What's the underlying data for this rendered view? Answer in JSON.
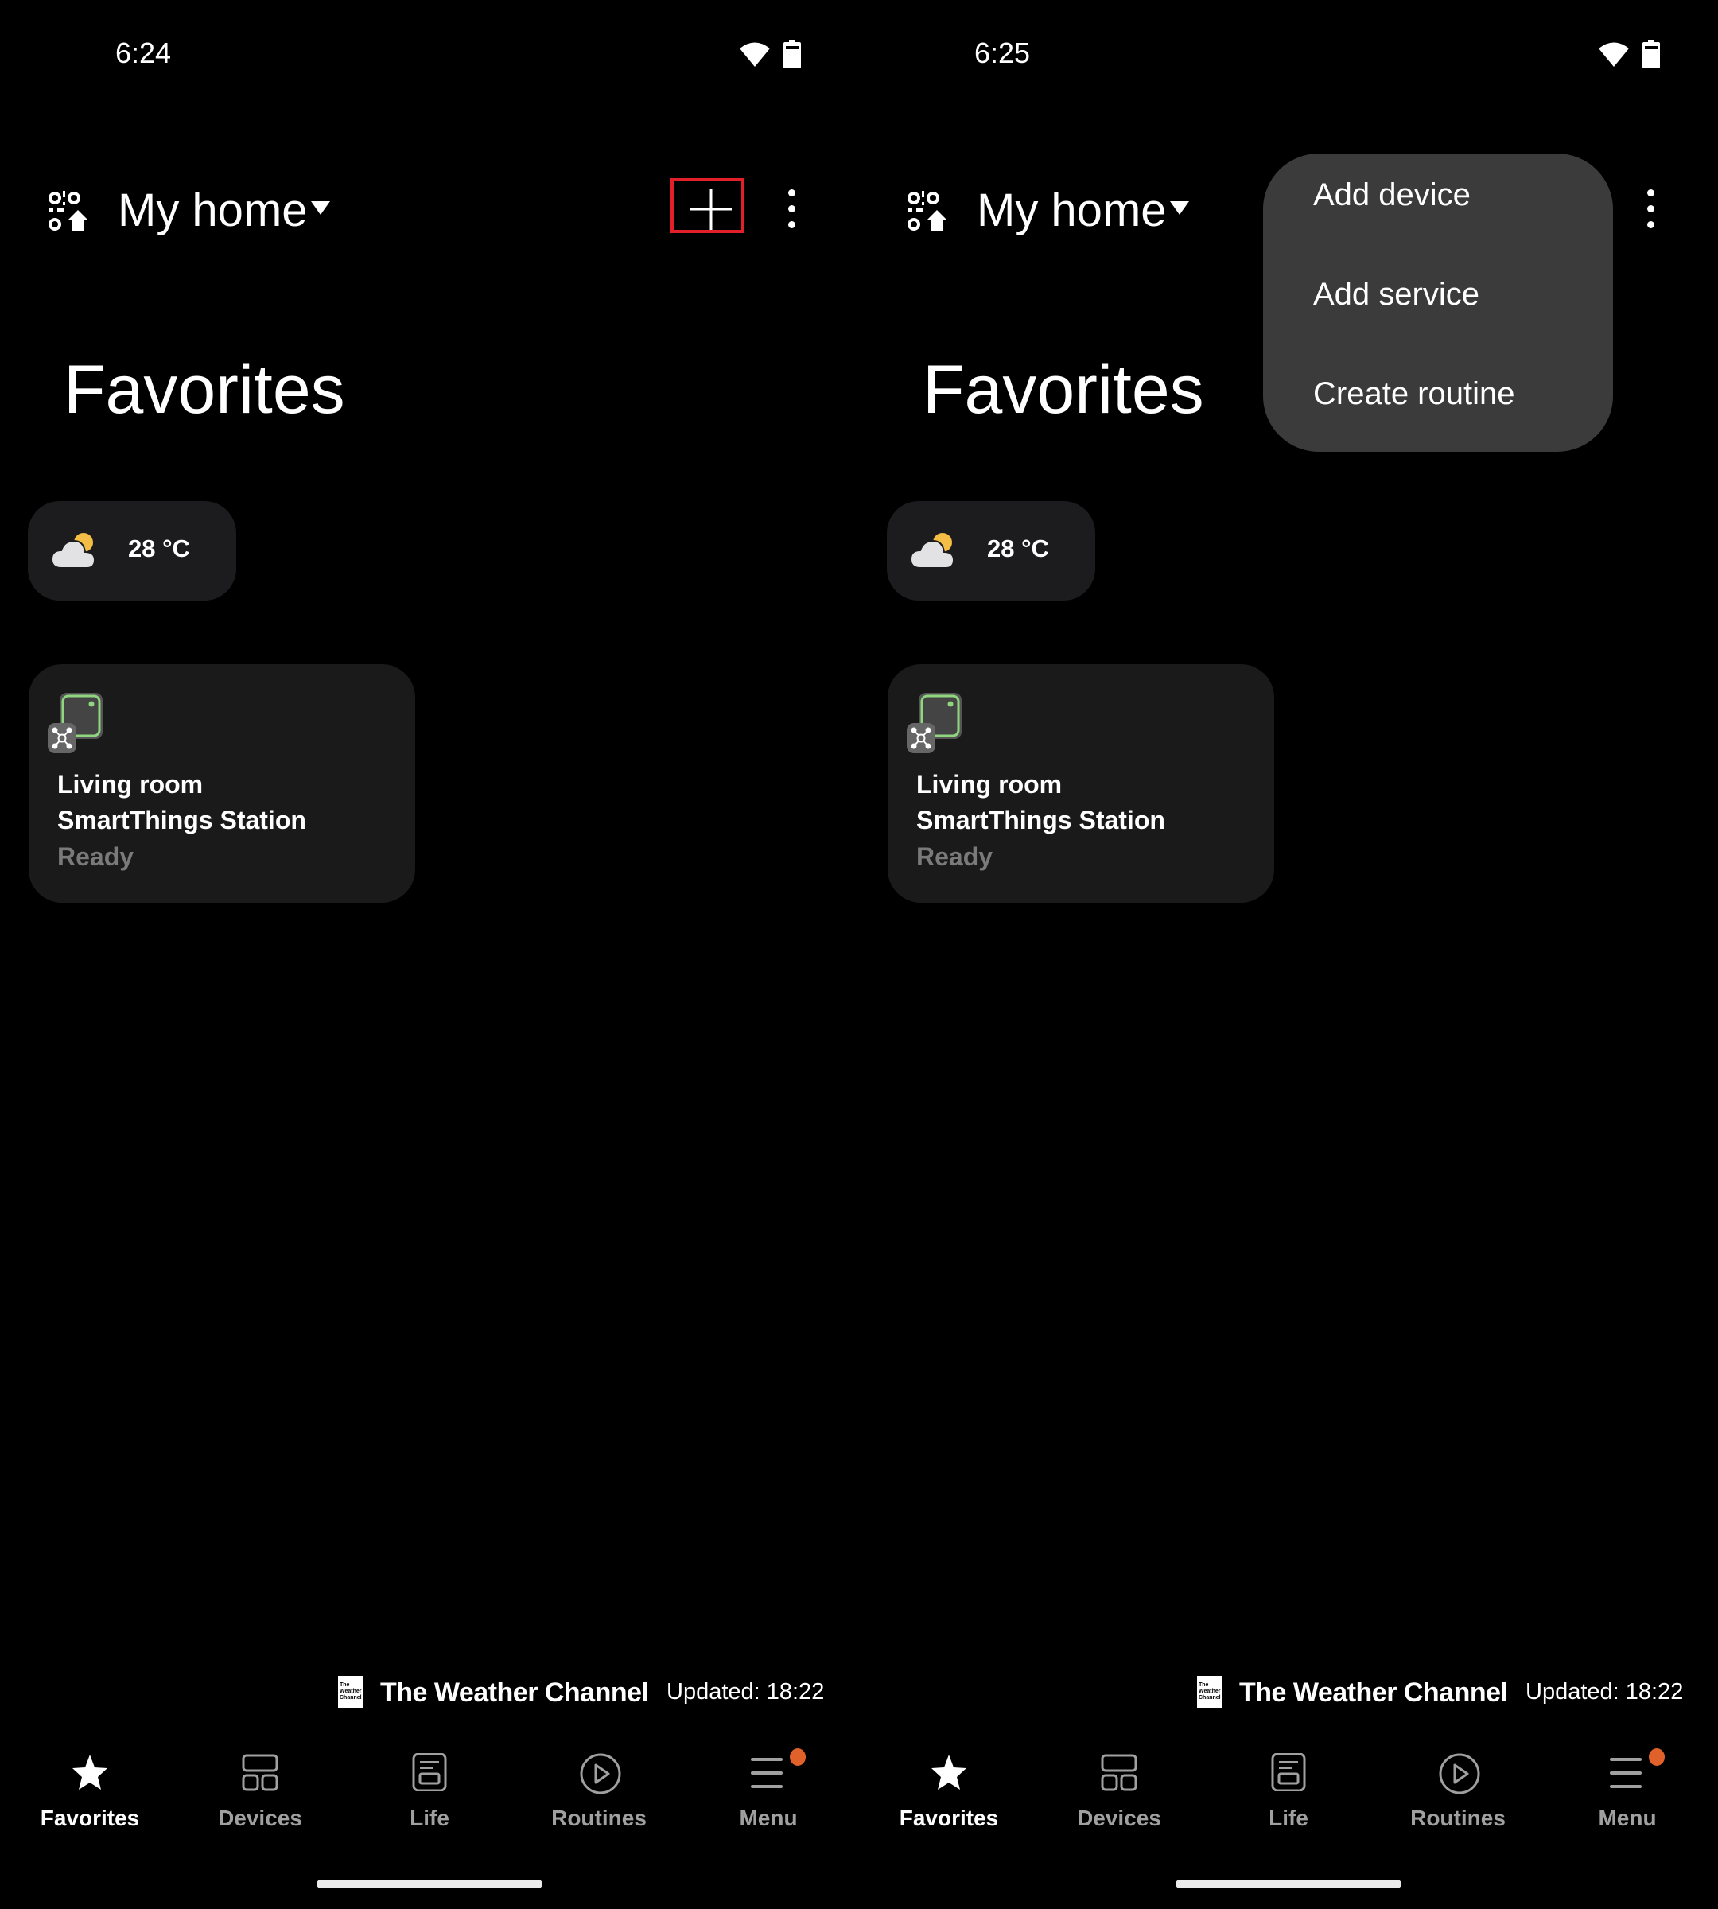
{
  "screens": [
    {
      "status_bar": {
        "time": "6:24",
        "wifi_icon": "wifi-icon",
        "battery_icon": "battery-icon"
      },
      "header": {
        "home_selector_icon": "home-location-icon",
        "title": "My home",
        "caret_icon": "caret-down-icon",
        "add_icon": "plus-icon",
        "more_icon": "more-vert-icon",
        "add_highlighted": true
      },
      "page_title": "Favorites",
      "weather": {
        "icon": "partly-cloudy-icon",
        "temperature": "28 °C"
      },
      "device_card": {
        "icon": "smartthings-station-icon",
        "room": "Living room",
        "name": "SmartThings Station",
        "status": "Ready"
      },
      "attribution": {
        "logo_text": "The Weather Channel",
        "provider": "The Weather Channel",
        "updated": "Updated: 18:22"
      },
      "nav": [
        {
          "label": "Favorites",
          "icon": "star-icon",
          "active": true
        },
        {
          "label": "Devices",
          "icon": "devices-grid-icon",
          "active": false
        },
        {
          "label": "Life",
          "icon": "life-icon",
          "active": false
        },
        {
          "label": "Routines",
          "icon": "play-circle-icon",
          "active": false
        },
        {
          "label": "Menu",
          "icon": "menu-icon",
          "active": false,
          "badge": true
        }
      ]
    },
    {
      "status_bar": {
        "time": "6:25",
        "wifi_icon": "wifi-icon",
        "battery_icon": "battery-icon"
      },
      "header": {
        "home_selector_icon": "home-location-icon",
        "title": "My home",
        "caret_icon": "caret-down-icon",
        "more_icon": "more-vert-icon"
      },
      "page_title": "Favorites",
      "popup_menu": {
        "items": [
          "Add device",
          "Add service",
          "Create routine"
        ]
      },
      "weather": {
        "icon": "partly-cloudy-icon",
        "temperature": "28 °C"
      },
      "device_card": {
        "icon": "smartthings-station-icon",
        "room": "Living room",
        "name": "SmartThings Station",
        "status": "Ready"
      },
      "attribution": {
        "logo_text": "The Weather Channel",
        "provider": "The Weather Channel",
        "updated": "Updated: 18:22"
      },
      "nav": [
        {
          "label": "Favorites",
          "icon": "star-icon",
          "active": true
        },
        {
          "label": "Devices",
          "icon": "devices-grid-icon",
          "active": false
        },
        {
          "label": "Life",
          "icon": "life-icon",
          "active": false
        },
        {
          "label": "Routines",
          "icon": "play-circle-icon",
          "active": false
        },
        {
          "label": "Menu",
          "icon": "menu-icon",
          "active": false,
          "badge": true
        }
      ]
    }
  ],
  "colors": {
    "background": "#000000",
    "card": "#1a1a1a",
    "popup": "#3b3b3b",
    "highlight": "#e2202a",
    "badge": "#e0622a",
    "device_accent": "#8fd67f",
    "sun": "#f4bd45",
    "muted_text": "#7a7a7a",
    "nav_inactive": "#a0a0a0"
  }
}
